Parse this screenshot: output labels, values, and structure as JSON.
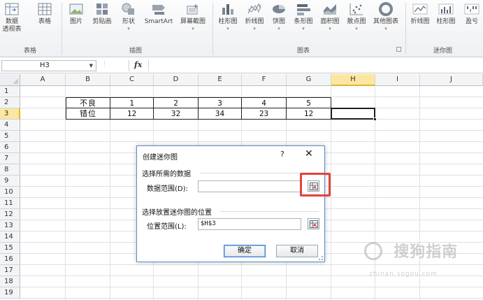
{
  "ribbon": {
    "groups": [
      {
        "label": "表格"
      },
      {
        "label": "插图"
      },
      {
        "label": "图表"
      },
      {
        "label": "迷你图"
      }
    ],
    "buttons": [
      {
        "label": "数据\n透视表",
        "caret": "▾",
        "icon": "pivot-table-icon"
      },
      {
        "label": "表格",
        "icon": "table-icon"
      },
      {
        "label": "图片",
        "icon": "picture-icon"
      },
      {
        "label": "剪贴画",
        "icon": "clipart-icon"
      },
      {
        "label": "形状",
        "caret": "▾",
        "icon": "shapes-icon"
      },
      {
        "label": "SmartArt",
        "icon": "smartart-icon"
      },
      {
        "label": "屏幕截图",
        "caret": "▾",
        "icon": "screenshot-icon"
      },
      {
        "label": "柱形图",
        "caret": "▾",
        "icon": "column-chart-icon"
      },
      {
        "label": "折线图",
        "caret": "▾",
        "icon": "line-chart-icon"
      },
      {
        "label": "饼图",
        "caret": "▾",
        "icon": "pie-chart-icon"
      },
      {
        "label": "条形图",
        "caret": "▾",
        "icon": "bar-chart-icon"
      },
      {
        "label": "面积图",
        "caret": "▾",
        "icon": "area-chart-icon"
      },
      {
        "label": "散点图",
        "caret": "▾",
        "icon": "scatter-chart-icon"
      },
      {
        "label": "其他图表",
        "caret": "▾",
        "icon": "other-charts-icon"
      },
      {
        "label": "折线图",
        "icon": "sparkline-line-icon"
      },
      {
        "label": "柱形图",
        "icon": "sparkline-column-icon"
      },
      {
        "label": "盈亏",
        "icon": "sparkline-winloss-icon"
      }
    ]
  },
  "formula_bar": {
    "name_box": "H3",
    "fx": "fx",
    "formula": ""
  },
  "grid": {
    "columns": [
      "A",
      "B",
      "C",
      "D",
      "E",
      "F",
      "G",
      "H",
      "I",
      "J"
    ],
    "selected_column": "H",
    "rows": [
      "1",
      "2",
      "3",
      "4",
      "5",
      "6",
      "7",
      "8",
      "9",
      "10",
      "11",
      "12",
      "13",
      "14",
      "15",
      "16",
      "17",
      "18",
      "19"
    ],
    "selected_row": "3",
    "active_cell": "H3",
    "table": [
      [
        "不良",
        "1",
        "2",
        "3",
        "4",
        "5"
      ],
      [
        "错位",
        "12",
        "32",
        "34",
        "23",
        "12"
      ]
    ]
  },
  "dialog": {
    "title": "创建迷你图",
    "help": "?",
    "close": "✕",
    "section_data": "选择所需的数据",
    "data_range_label": "数据范围(D):",
    "data_range_value": "",
    "section_location": "选择放置迷你图的位置",
    "location_range_label": "位置范围(L):",
    "location_range_value": "$H$3",
    "ok_label": "确定",
    "cancel_label": "取消"
  },
  "watermark": {
    "text": "搜狗指南",
    "sub": "zhinan.sogou.com"
  },
  "colors": {
    "accent_highlight": "#e0443e",
    "selected_header": "#fbe7a0",
    "dialog_border": "#5b8fc7"
  }
}
